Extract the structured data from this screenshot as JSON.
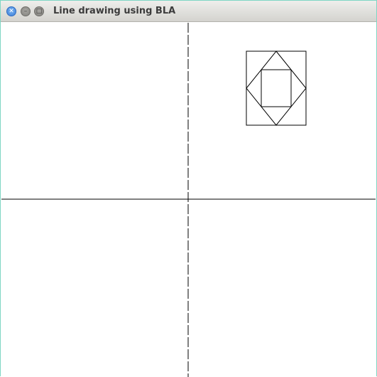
{
  "window": {
    "title": "Line drawing using BLA",
    "controls": {
      "close_icon": "close-icon",
      "minimize_icon": "minimize-icon",
      "maximize_icon": "maximize-icon"
    }
  },
  "colors": {
    "stroke": "#000000",
    "canvas_background": "#ffffff",
    "close_button": "#4a8ae0",
    "window_border": "#7fd6c4"
  }
}
